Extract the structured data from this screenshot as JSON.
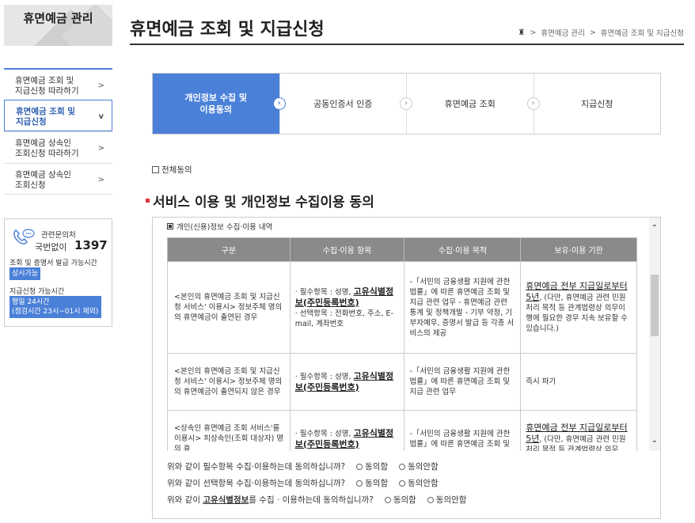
{
  "sidebar": {
    "title": "휴면예금 관리",
    "items": [
      {
        "label1": "휴면예금 조회 및",
        "label2": "지급신청 따라하기",
        "arrow": ">"
      },
      {
        "label1": "휴면예금 조회 및",
        "label2": "지급신청",
        "arrow": "v"
      },
      {
        "label1": "휴면예금 상속인",
        "label2": "조회신청 따라하기",
        "arrow": ">"
      },
      {
        "label1": "휴면예금 상속인",
        "label2": "조회신청",
        "arrow": ">"
      }
    ],
    "contact": {
      "label": "관련문의처",
      "num_label": "국번없이",
      "number": "1397",
      "cert_hours": "조회 및 증명서 발급 가능시간",
      "always": "상시가능",
      "pay_hours": "지급신청 가능시간",
      "pay_detail1": "평일 24시간",
      "pay_detail2": "(점검시간 23시~01시 제외)"
    }
  },
  "header": {
    "title": "휴면예금 조회 및 지급신청",
    "breadcrumb": [
      "휴면예금 관리",
      "휴면예금 조회 및 지급신청"
    ],
    "home_icon": "home-icon",
    "sep": ">"
  },
  "steps": [
    {
      "label1": "개인정보 수집 및",
      "label2": "이용동의"
    },
    {
      "label1": "공동인증서 인증",
      "label2": ""
    },
    {
      "label1": "휴면예금 조회",
      "label2": ""
    },
    {
      "label1": "지급신청",
      "label2": ""
    }
  ],
  "agree_all": "전체동의",
  "section_title": "서비스 이용 및 개인정보 수집이용 동의",
  "consent": {
    "caption": "개인(신용)정보 수집·이용 내역",
    "headers": [
      "구분",
      "수집·이용 항목",
      "수집·이용 목적",
      "보유·이용 기한"
    ],
    "rows": [
      {
        "c1": "<본인의 휴면예금 조회 및 지급신청 서비스' 이용시> 정보주체 명의의 휴면예금이 출연된 경우",
        "c2_req_pre": "필수항목 : 성명, ",
        "c2_req_u": "고유식별정보(주민등록번호)",
        "c2_opt": "선택항목 : 전화번호, 주소, E-mail, 계좌번호",
        "c3": "-「서민의 금융생활 지원에 관한 법률」에 따른 휴면예금 조회 및 지급 관련 업무 - 휴면예금 관련 통계 및 정책개발 - 기부 약정, 기부자예우, 증명서 발급 등 각종 서비스의 제공",
        "c4_u": "휴면예금 전부 지급일로부터 5년",
        "c4_rest": ", (다만, 휴면예금 관련 민원처리 목적 등 관계법령상 의무이행에 필요한 경우 지속 보유할 수 있습니다.)"
      },
      {
        "c1": "<본인의 휴면예금 조회 및 지급신청 서비스' 이용시> 정보주체 명의의 휴면예금이 출연되지 않은 경우",
        "c2_req_pre": "필수항목 : 성명, ",
        "c2_req_u": "고유식별정보(주민등록번호)",
        "c3": "-「서민의 금융생활 지원에 관한 법률」에 따른 휴면예금 조회 및 지급 관련 업무",
        "c4": "즉시 파기"
      },
      {
        "c1": "<상속인 휴면예금 조회 서비스'를 이용시> 피상속인(조회 대상자) 명의 휴",
        "c2_req_pre": "필수항목 : 성명, ",
        "c2_req_u": "고유식별정보(주민등록번호)",
        "c3": "-「서민의 금융생활 지원에 관한 법률」에 따른 휴면예금 조회 및",
        "c4_u": "휴면예금 전부 지급일로부터 5년",
        "c4_rest": ", (다만, 휴면예금 관련 민원처리 목적 등 관계법령상 의무"
      }
    ],
    "questions": [
      {
        "pre": "위와 같이 필수항목 수집·이용하는데 동의하십니까?",
        "u": "",
        "post": ""
      },
      {
        "pre": "위와 같이 선택항목 수집·이용하는데 동의하십니까?",
        "u": "",
        "post": ""
      },
      {
        "pre": "위와 같이 ",
        "u": "고유식별정보",
        "post": "를 수집 · 이용하는데 동의하십니까?"
      }
    ],
    "agree": "동의함",
    "disagree": "동의안함"
  }
}
